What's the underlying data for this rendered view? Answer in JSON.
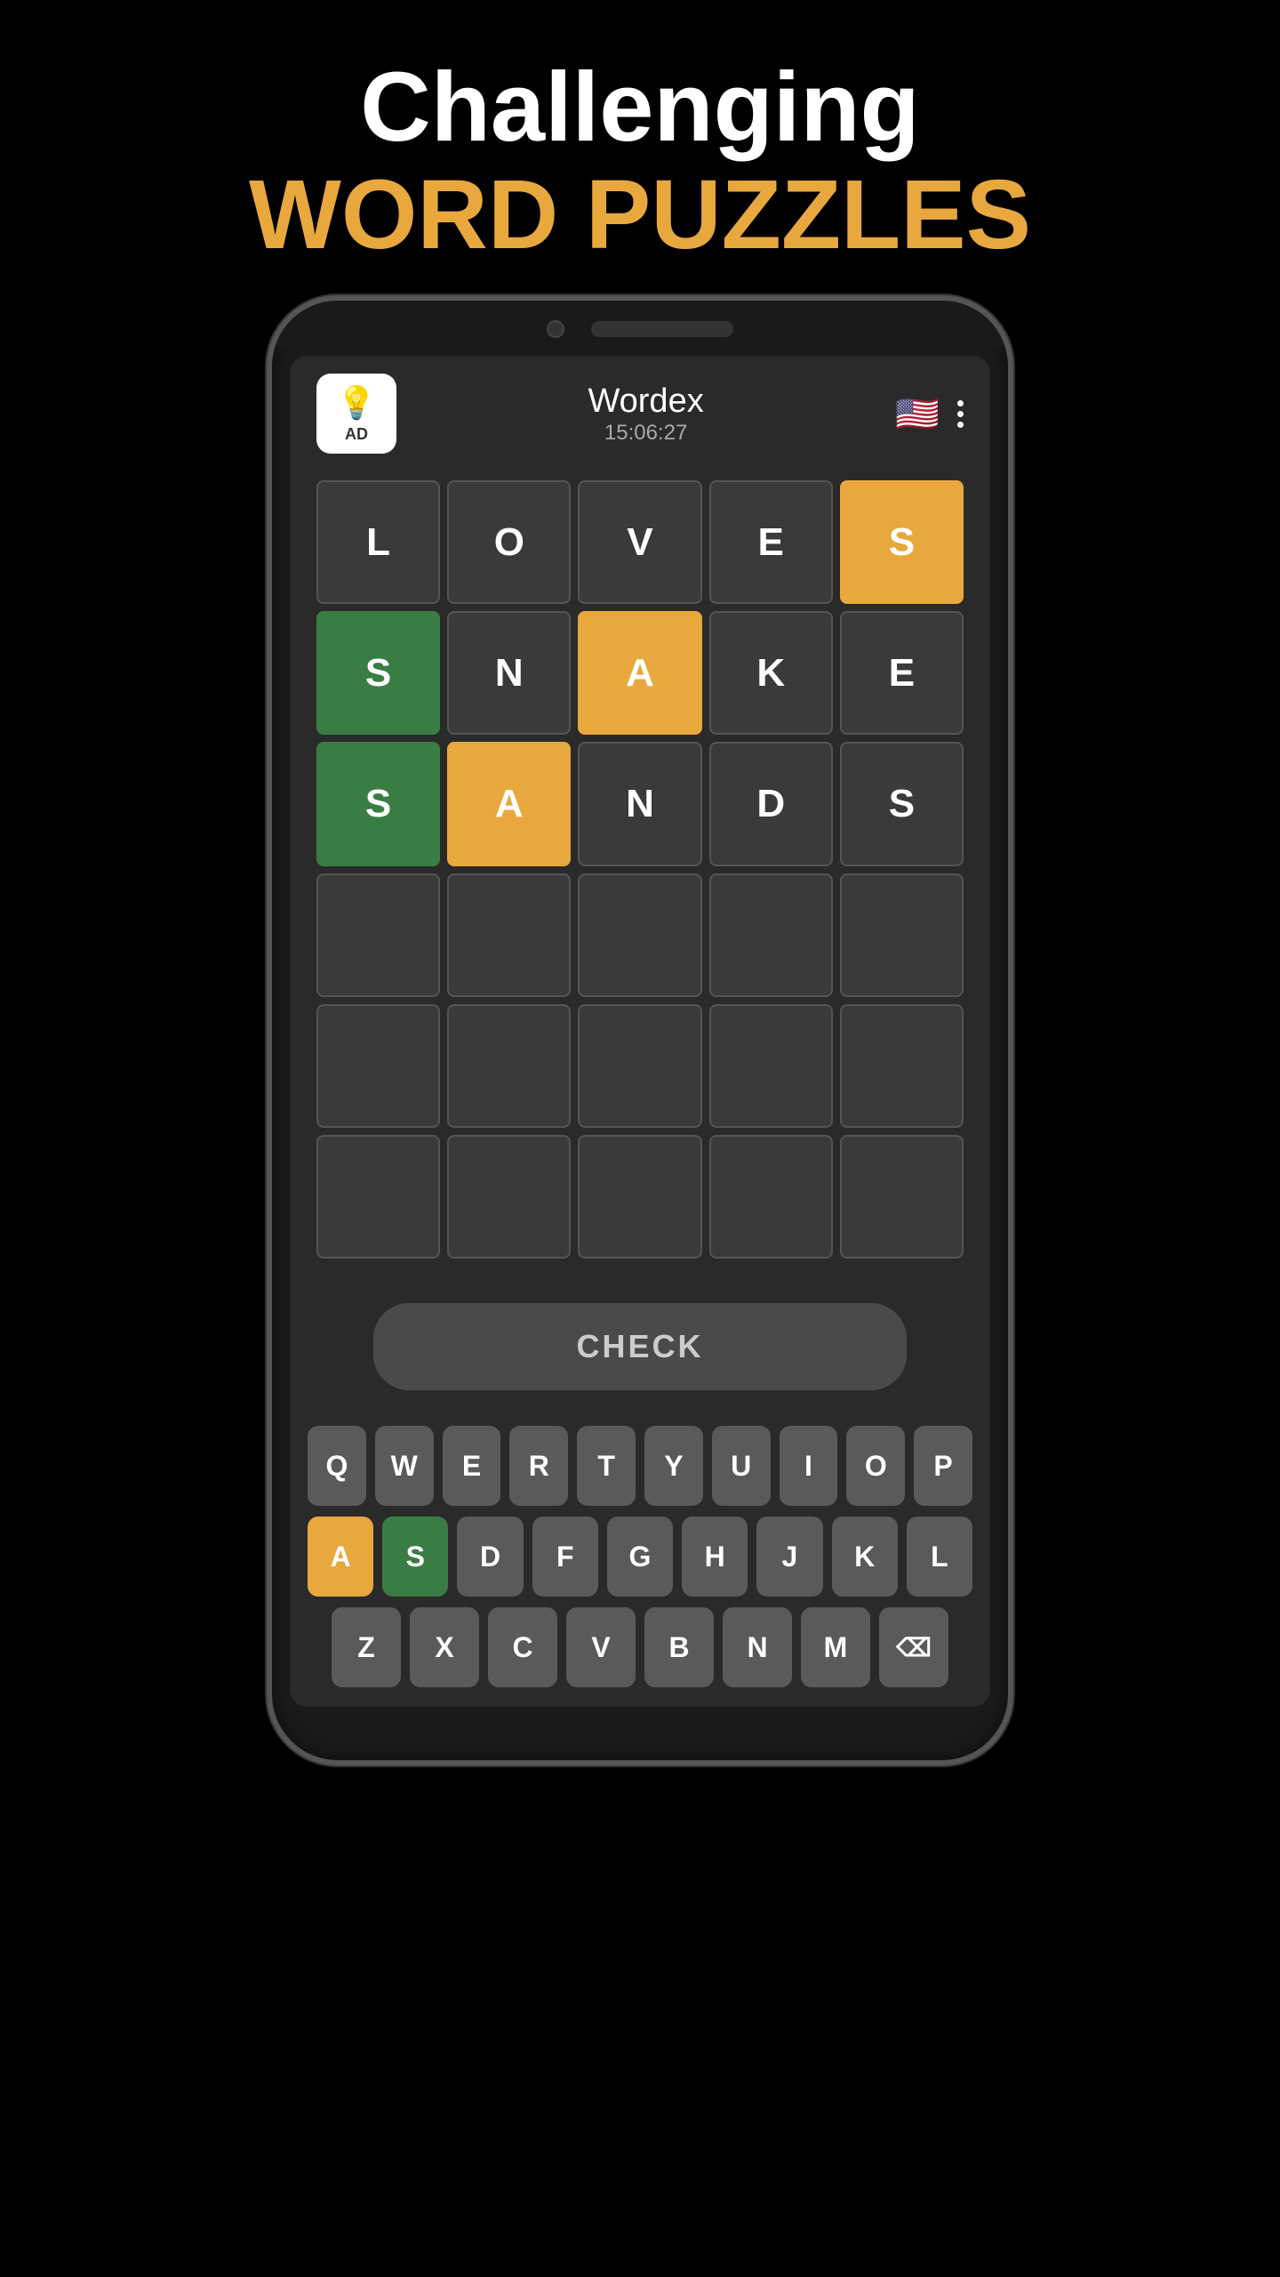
{
  "header": {
    "line1": "Challenging",
    "line2": "WORD PUZZLES"
  },
  "app": {
    "title": "Wordex",
    "timer": "15:06:27",
    "ad_label": "AD"
  },
  "grid": {
    "rows": [
      [
        {
          "letter": "L",
          "state": "empty"
        },
        {
          "letter": "O",
          "state": "empty"
        },
        {
          "letter": "V",
          "state": "empty"
        },
        {
          "letter": "E",
          "state": "empty"
        },
        {
          "letter": "S",
          "state": "yellow"
        }
      ],
      [
        {
          "letter": "S",
          "state": "green"
        },
        {
          "letter": "N",
          "state": "empty"
        },
        {
          "letter": "A",
          "state": "yellow"
        },
        {
          "letter": "K",
          "state": "empty"
        },
        {
          "letter": "E",
          "state": "empty"
        }
      ],
      [
        {
          "letter": "S",
          "state": "green"
        },
        {
          "letter": "A",
          "state": "yellow"
        },
        {
          "letter": "N",
          "state": "empty"
        },
        {
          "letter": "D",
          "state": "empty"
        },
        {
          "letter": "S",
          "state": "empty"
        }
      ],
      [
        {
          "letter": "",
          "state": "empty"
        },
        {
          "letter": "",
          "state": "empty"
        },
        {
          "letter": "",
          "state": "empty"
        },
        {
          "letter": "",
          "state": "empty"
        },
        {
          "letter": "",
          "state": "empty"
        }
      ],
      [
        {
          "letter": "",
          "state": "empty"
        },
        {
          "letter": "",
          "state": "empty"
        },
        {
          "letter": "",
          "state": "empty"
        },
        {
          "letter": "",
          "state": "empty"
        },
        {
          "letter": "",
          "state": "empty"
        }
      ],
      [
        {
          "letter": "",
          "state": "empty"
        },
        {
          "letter": "",
          "state": "empty"
        },
        {
          "letter": "",
          "state": "empty"
        },
        {
          "letter": "",
          "state": "empty"
        },
        {
          "letter": "",
          "state": "empty"
        }
      ]
    ]
  },
  "check_button": "CHECK",
  "keyboard": {
    "row1": [
      {
        "key": "Q",
        "state": "normal"
      },
      {
        "key": "W",
        "state": "normal"
      },
      {
        "key": "E",
        "state": "normal"
      },
      {
        "key": "R",
        "state": "normal"
      },
      {
        "key": "T",
        "state": "normal"
      },
      {
        "key": "Y",
        "state": "normal"
      },
      {
        "key": "U",
        "state": "normal"
      },
      {
        "key": "I",
        "state": "normal"
      },
      {
        "key": "O",
        "state": "normal"
      },
      {
        "key": "P",
        "state": "normal"
      }
    ],
    "row2": [
      {
        "key": "A",
        "state": "yellow"
      },
      {
        "key": "S",
        "state": "green"
      },
      {
        "key": "D",
        "state": "normal"
      },
      {
        "key": "F",
        "state": "normal"
      },
      {
        "key": "G",
        "state": "normal"
      },
      {
        "key": "H",
        "state": "normal"
      },
      {
        "key": "J",
        "state": "normal"
      },
      {
        "key": "K",
        "state": "normal"
      },
      {
        "key": "L",
        "state": "normal"
      }
    ],
    "row3": [
      {
        "key": "Z",
        "state": "normal"
      },
      {
        "key": "X",
        "state": "normal"
      },
      {
        "key": "C",
        "state": "normal"
      },
      {
        "key": "V",
        "state": "normal"
      },
      {
        "key": "B",
        "state": "normal"
      },
      {
        "key": "N",
        "state": "normal"
      },
      {
        "key": "M",
        "state": "normal"
      },
      {
        "key": "⌫",
        "state": "normal"
      }
    ]
  }
}
